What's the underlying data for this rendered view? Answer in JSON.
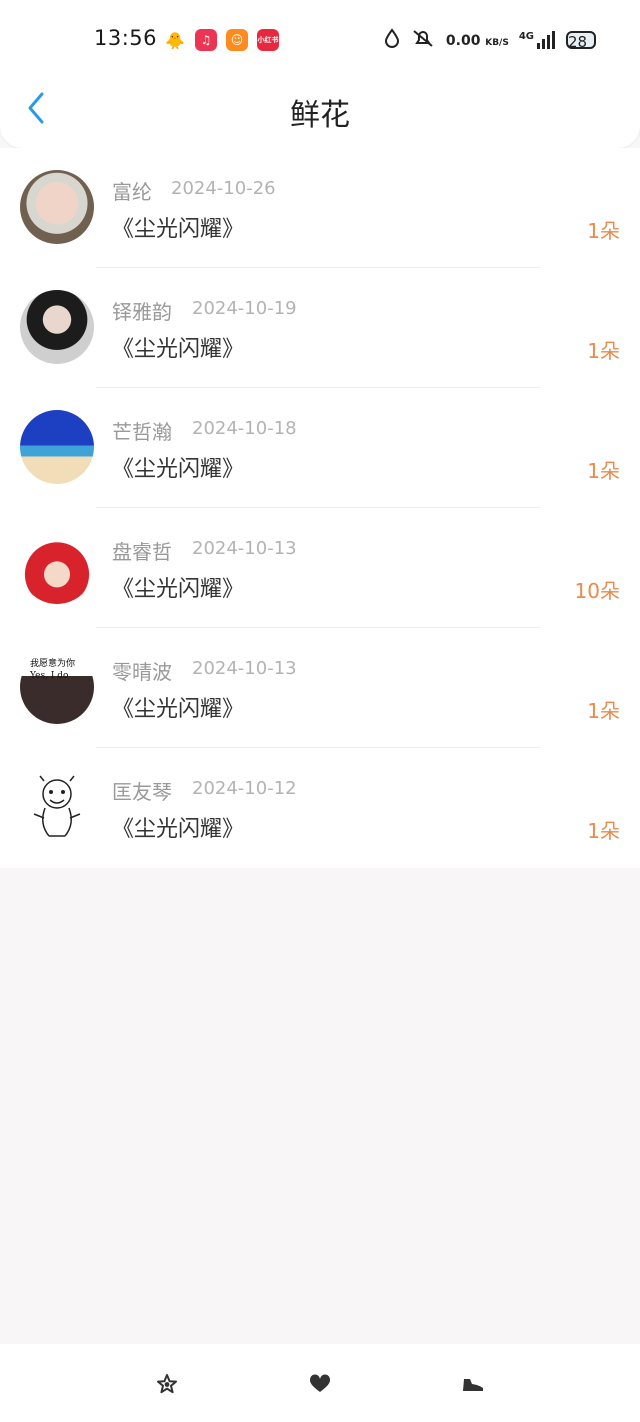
{
  "status_bar": {
    "time": "13:56",
    "app_icons": [
      "🐥",
      "♫",
      "☺",
      "小红书"
    ],
    "net_speed_value": "0.00",
    "net_speed_unit": "KB/S",
    "signal": "4G",
    "battery": "28"
  },
  "header": {
    "title": "鲜花"
  },
  "gifts": [
    {
      "nickname": "富纶",
      "date": "2024-10-26",
      "gift": "《尘光闪耀》",
      "count": "1朵",
      "avatar": "avatar-glasses"
    },
    {
      "nickname": "铎雅韵",
      "date": "2024-10-19",
      "gift": "《尘光闪耀》",
      "count": "1朵",
      "avatar": "avatar-man-black"
    },
    {
      "nickname": "芒哲瀚",
      "date": "2024-10-18",
      "gift": "《尘光闪耀》",
      "count": "1朵",
      "avatar": "avatar-beach"
    },
    {
      "nickname": "盘睿哲",
      "date": "2024-10-13",
      "gift": "《尘光闪耀》",
      "count": "10朵",
      "avatar": "avatar-cartoon-red-hair"
    },
    {
      "nickname": "零晴波",
      "date": "2024-10-13",
      "gift": "《尘光闪耀》",
      "count": "1朵",
      "avatar": "avatar-caption"
    },
    {
      "nickname": "匡友琴",
      "date": "2024-10-12",
      "gift": "《尘光闪耀》",
      "count": "1朵",
      "avatar": "avatar-tiger-sketch"
    }
  ],
  "avatar_captions": {
    "line1": "我愿意为你",
    "line2": "Yes, I do"
  },
  "bottom_nav": [
    "star-icon",
    "heart-icon",
    "shoe-icon"
  ],
  "colors": {
    "accent_back": "#2a9be8",
    "count": "#ec8a4a",
    "background": "#f8f6f7"
  }
}
